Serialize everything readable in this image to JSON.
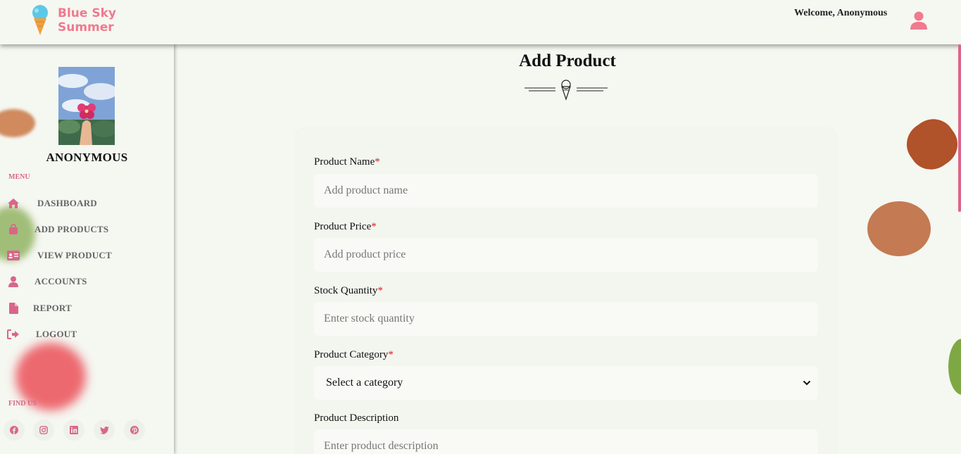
{
  "header": {
    "brand_line1": "Blue Sky",
    "brand_line2": "Summer",
    "welcome": "Welcome, Anonymous"
  },
  "sidebar": {
    "profile_name": "ANONYMOUS",
    "menu_label": "MENU",
    "items": [
      {
        "label": "DASHBOARD",
        "icon": "home-icon"
      },
      {
        "label": "ADD PRODUCTS",
        "icon": "bag-icon"
      },
      {
        "label": "VIEW PRODUCT",
        "icon": "id-card-icon"
      },
      {
        "label": "ACCOUNTS",
        "icon": "user-icon"
      },
      {
        "label": "REPORT",
        "icon": "file-icon"
      },
      {
        "label": "LOGOUT",
        "icon": "logout-icon"
      }
    ],
    "findus_label": "FIND US",
    "socials": [
      "facebook-icon",
      "instagram-icon",
      "linkedin-icon",
      "twitter-icon",
      "pinterest-icon"
    ]
  },
  "main": {
    "title": "Add Product",
    "form": {
      "required_mark": "*",
      "product_name": {
        "label": "Product Name",
        "placeholder": "Add product name"
      },
      "product_price": {
        "label": "Product Price",
        "placeholder": "Add product price"
      },
      "stock_quantity": {
        "label": "Stock Quantity",
        "placeholder": "Enter stock quantity"
      },
      "product_category": {
        "label": "Product Category",
        "selected": "Select a category"
      },
      "product_description": {
        "label": "Product Description",
        "placeholder": "Enter product description"
      }
    }
  },
  "colors": {
    "accent": "#d9668a",
    "brand": "#f07a8e",
    "background": "#f5f7f1",
    "required": "#e01a1a"
  }
}
